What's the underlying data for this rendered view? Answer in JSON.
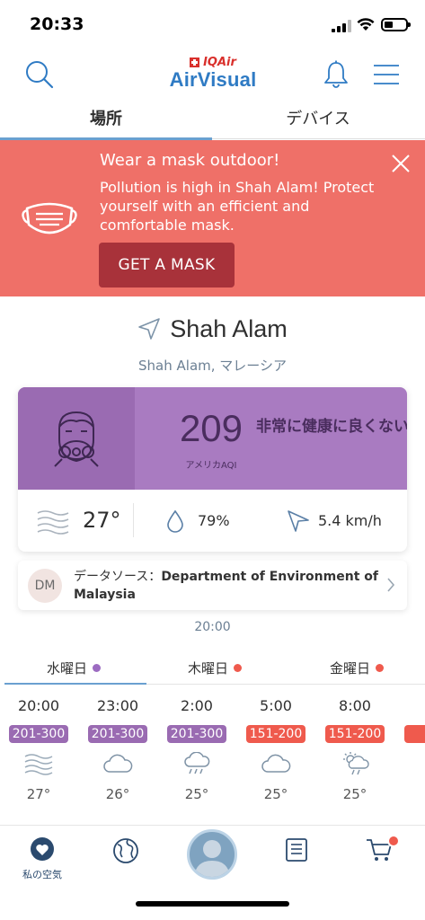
{
  "status_bar": {
    "time": "20:33"
  },
  "tabs": {
    "places": "場所",
    "devices": "デバイス"
  },
  "logo": {
    "brand_top": "IQAir",
    "brand_main": "AirVisual"
  },
  "banner": {
    "title": "Wear a mask outdoor!",
    "text": "Pollution is high in Shah Alam! Protect yourself with an efficient and comfortable mask.",
    "button": "GET A MASK",
    "color": "#ef7068"
  },
  "location": {
    "name": "Shah Alam",
    "subtitle": "Shah Alam, マレーシア"
  },
  "aqi": {
    "value": "209",
    "unit": "アメリカAQI",
    "status": "非常に健康に良くない",
    "color": "#a97bc1"
  },
  "weather": {
    "temperature": "27°",
    "humidity": "79%",
    "wind": "5.4 km/h"
  },
  "source": {
    "badge": "DM",
    "label": "データソース：",
    "org": "Department of Environment of Malaysia"
  },
  "updated": "20:00",
  "days": [
    {
      "label": "水曜日",
      "dot": "#9c6bc1"
    },
    {
      "label": "木曜日",
      "dot": "#ef5a4d"
    },
    {
      "label": "金曜日",
      "dot": "#ef5a4d"
    }
  ],
  "hours": [
    {
      "time": "20:00",
      "aqi": "201-300",
      "aqi_color": "#9a6bb2",
      "icon": "haze-icon",
      "temp": "27°"
    },
    {
      "time": "23:00",
      "aqi": "201-300",
      "aqi_color": "#9a6bb2",
      "icon": "cloud-icon",
      "temp": "26°"
    },
    {
      "time": "2:00",
      "aqi": "201-300",
      "aqi_color": "#9a6bb2",
      "icon": "cloud-rain-icon",
      "temp": "25°"
    },
    {
      "time": "5:00",
      "aqi": "151-200",
      "aqi_color": "#ef5a4d",
      "icon": "cloud-icon",
      "temp": "25°"
    },
    {
      "time": "8:00",
      "aqi": "151-200",
      "aqi_color": "#ef5a4d",
      "icon": "sun-rain-icon",
      "temp": "25°"
    }
  ],
  "bottom_nav": {
    "my_air": "私の空気"
  }
}
